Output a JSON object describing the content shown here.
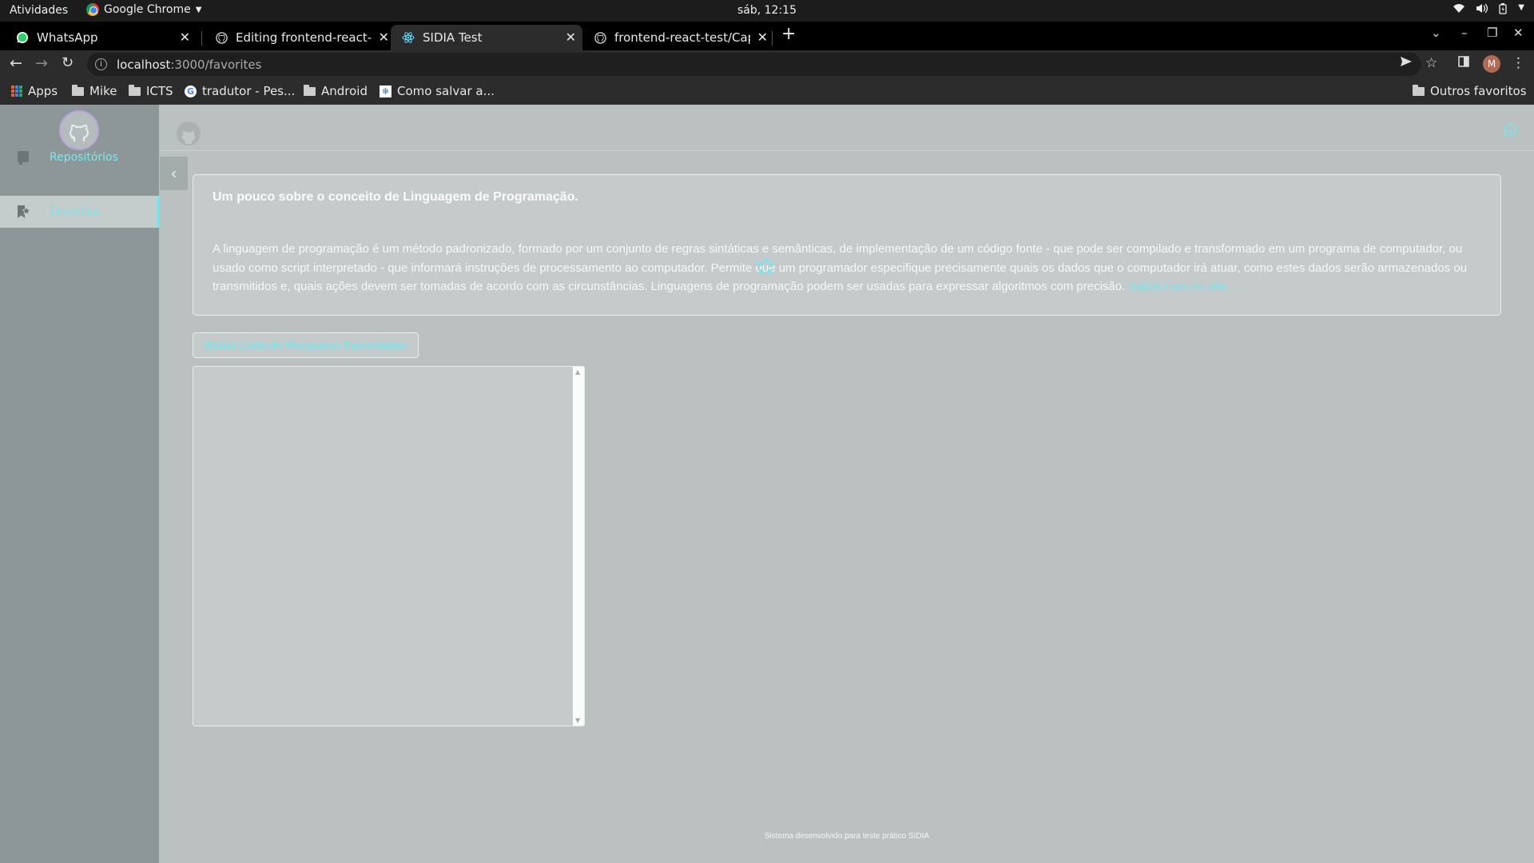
{
  "system": {
    "activities": "Atividades",
    "app_name": "Google Chrome",
    "clock": "sáb, 12:15"
  },
  "tabs": [
    {
      "title": "WhatsApp",
      "icon": "whatsapp-icon"
    },
    {
      "title": "Editing frontend-react-test",
      "icon": "github-icon"
    },
    {
      "title": "SIDIA Test",
      "icon": "react-icon",
      "active": true
    },
    {
      "title": "frontend-react-test/Capture",
      "icon": "github-icon"
    }
  ],
  "address_bar": {
    "host": "localhost",
    "path": ":3000/favorites"
  },
  "bookmarks": {
    "apps": "Apps",
    "items": [
      "Mike",
      "ICTS",
      "tradutor - Pes...",
      "Android",
      "Como salvar a..."
    ],
    "other": "Outros favoritos"
  },
  "profile_initial": "M",
  "sidebar": {
    "items": [
      {
        "label": "Repositórios"
      },
      {
        "label": "Favoritos",
        "active": true
      }
    ]
  },
  "card": {
    "title": "Um pouco sobre o conceito de Linguagem de Programação.",
    "body": "A linguagem de programação é um método padronizado, formado por um conjunto de regras sintáticas e semânticas, de implementação de um código fonte - que pode ser compilado e transformado em um programa de computador, ou usado como script interpretado - que informará instruções de processamento ao computador. Permite que um programador especifique precisamente quais os dados que o computador irá atuar, como estes dados serão armazenados ou transmitidos e, quais ações devem ser tomadas de acordo com as circunstâncias. Linguagens de programação podem ser usadas para expressar algoritmos com precisão.",
    "link": "Saiba mais no site..."
  },
  "favorites_button": "Exibir Lista de Pesquisas Favoritadas",
  "footer": "Sistema desenvolvido para teste prático SIDIA",
  "colors": {
    "accent": "#7fe3ec",
    "sidebar_bg": "#8e9797",
    "page_bg": "#bbc1c1",
    "card_bg": "#c4cbca"
  }
}
